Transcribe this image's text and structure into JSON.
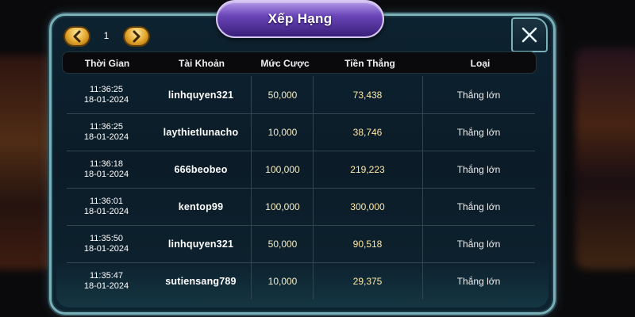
{
  "title": "Xếp Hạng",
  "pager": {
    "page": "1"
  },
  "colors": {
    "accent": "#7ab0b8",
    "title_tab": "#6a46b8",
    "arrow": "#e3a62c"
  },
  "icons": {
    "prev": "chevron-left-icon",
    "next": "chevron-right-icon",
    "close": "close-icon"
  },
  "table": {
    "headers": [
      "Thời Gian",
      "Tài Khoản",
      "Mức Cược",
      "Tiền Thắng",
      "Loại"
    ],
    "rows": [
      {
        "time": "11:36:25",
        "date": "18-01-2024",
        "account": "linhquyen321",
        "bet": "50,000",
        "win": "73,438",
        "type": "Thắng lớn"
      },
      {
        "time": "11:36:25",
        "date": "18-01-2024",
        "account": "laythietlunacho",
        "bet": "10,000",
        "win": "38,746",
        "type": "Thắng lớn"
      },
      {
        "time": "11:36:18",
        "date": "18-01-2024",
        "account": "666beobeo",
        "bet": "100,000",
        "win": "219,223",
        "type": "Thắng lớn"
      },
      {
        "time": "11:36:01",
        "date": "18-01-2024",
        "account": "kentop99",
        "bet": "100,000",
        "win": "300,000",
        "type": "Thắng lớn"
      },
      {
        "time": "11:35:50",
        "date": "18-01-2024",
        "account": "linhquyen321",
        "bet": "50,000",
        "win": "90,518",
        "type": "Thắng lớn"
      },
      {
        "time": "11:35:47",
        "date": "18-01-2024",
        "account": "sutiensang789",
        "bet": "10,000",
        "win": "29,375",
        "type": "Thắng lớn"
      }
    ]
  }
}
